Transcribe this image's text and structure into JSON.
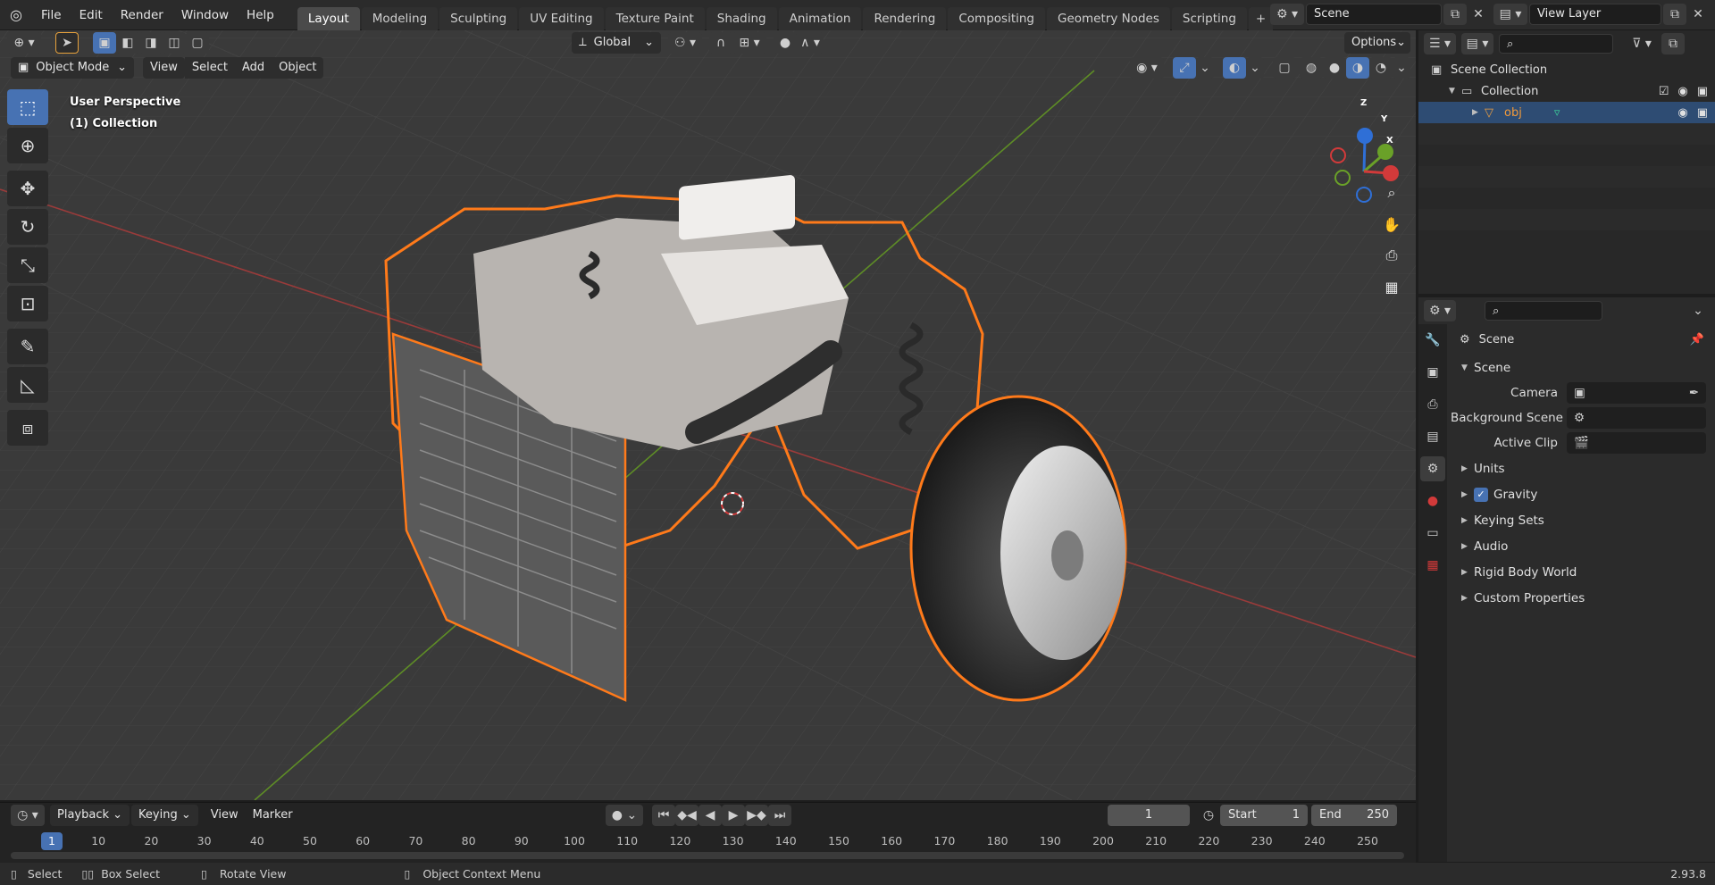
{
  "topbar": {
    "menus": [
      "File",
      "Edit",
      "Render",
      "Window",
      "Help"
    ],
    "workspaces": [
      "Layout",
      "Modeling",
      "Sculpting",
      "UV Editing",
      "Texture Paint",
      "Shading",
      "Animation",
      "Rendering",
      "Compositing",
      "Geometry Nodes",
      "Scripting"
    ],
    "active_workspace": "Layout",
    "scene_name": "Scene",
    "view_layer": "View Layer"
  },
  "viewport_header": {
    "transform_orientation": "Global",
    "options_label": "Options",
    "mode": "Object Mode",
    "menus": [
      "View",
      "Select",
      "Add",
      "Object"
    ]
  },
  "viewport": {
    "perspective_label": "User Perspective",
    "collection_label": "(1) Collection",
    "gizmo_axes": {
      "x": "X",
      "y": "Y",
      "z": "Z"
    },
    "colors": {
      "grid_bg": "#3a3a3a",
      "x_axis": "#b0413e",
      "y_axis": "#6a9a2a",
      "selection": "#ff7a1a"
    }
  },
  "outliner": {
    "root": "Scene Collection",
    "collection": "Collection",
    "object": "obj"
  },
  "properties": {
    "context_title": "Scene",
    "panel_scene": "Scene",
    "fields": [
      {
        "label": "Camera",
        "value": ""
      },
      {
        "label": "Background Scene",
        "value": ""
      },
      {
        "label": "Active Clip",
        "value": ""
      }
    ],
    "subpanels": [
      "Units",
      "Gravity",
      "Keying Sets",
      "Audio",
      "Rigid Body World",
      "Custom Properties"
    ],
    "gravity_checked": true
  },
  "timeline": {
    "menus": [
      "Playback",
      "Keying",
      "View",
      "Marker"
    ],
    "current_frame": "1",
    "start_label": "Start",
    "start_value": "1",
    "end_label": "End",
    "end_value": "250",
    "ruler_ticks": [
      "1",
      "10",
      "20",
      "30",
      "40",
      "50",
      "60",
      "70",
      "80",
      "90",
      "100",
      "110",
      "120",
      "130",
      "140",
      "150",
      "160",
      "170",
      "180",
      "190",
      "200",
      "210",
      "220",
      "230",
      "240",
      "250"
    ]
  },
  "statusbar": {
    "items": [
      "Select",
      "Box Select",
      "Rotate View",
      "Object Context Menu"
    ],
    "version": "2.93.8"
  }
}
